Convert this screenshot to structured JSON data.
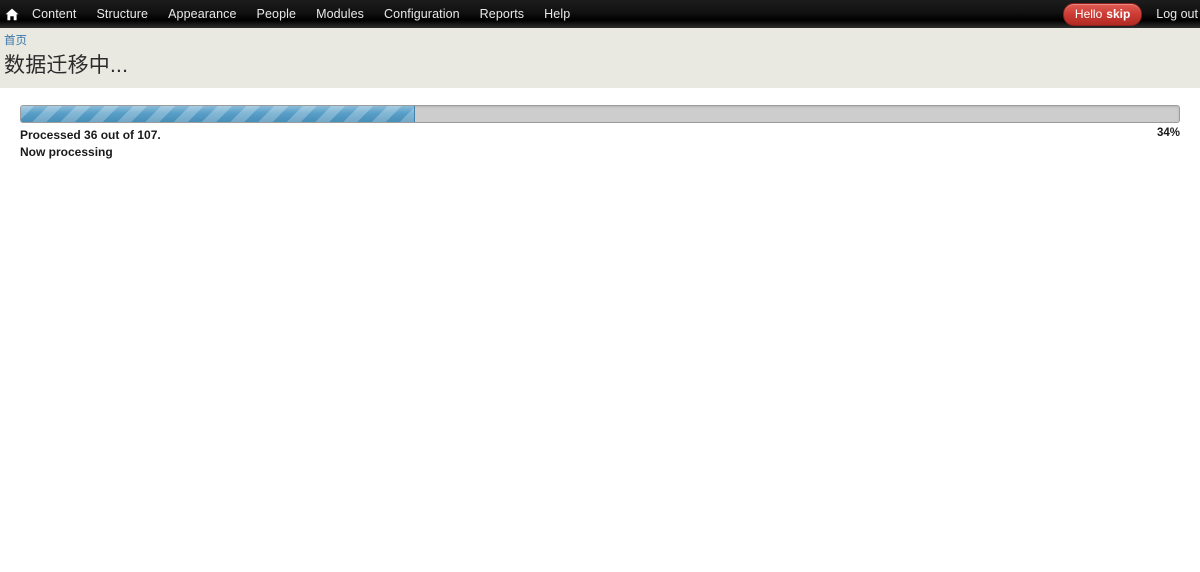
{
  "toolbar": {
    "home_icon": "home-icon",
    "menu_items": [
      {
        "label": "Content"
      },
      {
        "label": "Structure"
      },
      {
        "label": "Appearance"
      },
      {
        "label": "People"
      },
      {
        "label": "Modules"
      },
      {
        "label": "Configuration"
      },
      {
        "label": "Reports"
      },
      {
        "label": "Help"
      }
    ],
    "user_badge": {
      "greeting": "Hello",
      "username": "skip",
      "background_color": "#cc3b33"
    },
    "logout_label": "Log out",
    "background_color": "#000000"
  },
  "header": {
    "breadcrumb": "首页",
    "breadcrumb_color": "#3a76a8",
    "title": "数据迁移中...",
    "background_color": "#e9e9e1"
  },
  "progress": {
    "percent_label": "34%",
    "percent_value": 34,
    "message": "Processed 36 out of 107.",
    "label": "Now processing",
    "processed": 36,
    "total": 107,
    "fill_color": "#4d98c4",
    "track_color": "#cdcdcd"
  }
}
